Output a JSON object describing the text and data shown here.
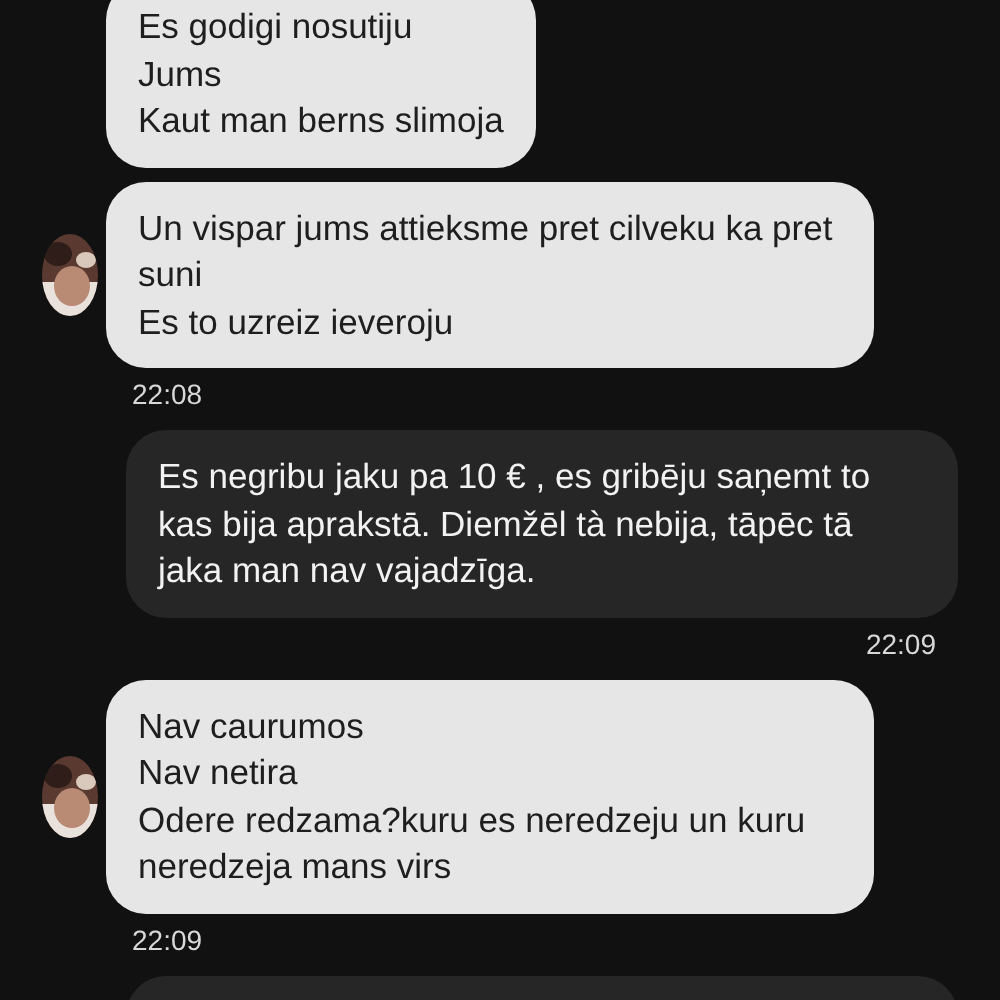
{
  "messages": [
    {
      "kind": "incoming",
      "avatar": false,
      "lines": [
        "Es godigi nosutiju",
        "Jums",
        "Kaut man berns slimoja"
      ]
    },
    {
      "kind": "incoming",
      "avatar": true,
      "lines": [
        "Un vispar jums attieksme pret cilveku ka pret suni",
        "Es to uzreiz ieveroju"
      ],
      "time": "22:08"
    },
    {
      "kind": "outgoing",
      "lines": [
        "Es negribu jaku pa 10 € , es gribēju saņemt to kas bija aprakstā. Diemžēl tà nebija, tāpēc tā jaka man nav vajadzīga."
      ],
      "time": "22:09"
    },
    {
      "kind": "incoming",
      "avatar": true,
      "lines": [
        "Nav caurumos",
        "Nav netira",
        "Odere redzama?kuru es neredzeju un kuru neredzeja mans virs"
      ],
      "time": "22:09"
    },
    {
      "kind": "outgoing"
    }
  ]
}
